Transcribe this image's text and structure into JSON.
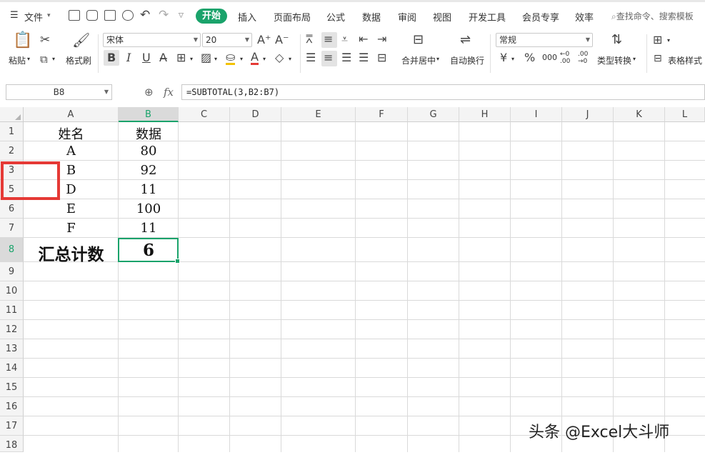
{
  "menu": {
    "file": "文件",
    "tabs": [
      "开始",
      "插入",
      "页面布局",
      "公式",
      "数据",
      "审阅",
      "视图",
      "开发工具",
      "会员专享",
      "效率"
    ],
    "search_placeholder": "查找命令、搜索模板"
  },
  "ribbon": {
    "paste": "粘贴",
    "format_painter": "格式刷",
    "font_name": "宋体",
    "font_size": "20",
    "merge_center": "合并居中",
    "wrap_text": "自动换行",
    "number_format": "常规",
    "type_convert": "类型转换",
    "table_style": "表格样式",
    "bold": "B",
    "italic": "I",
    "underline": "U",
    "currency": "¥",
    "percent": "%",
    "thousands": "000",
    "inc_decimal": "←0 .00",
    "dec_decimal": ".00 →0"
  },
  "formula_bar": {
    "name_box": "B8",
    "fx": "fx",
    "formula": "=SUBTOTAL(3,B2:B7)"
  },
  "columns": [
    "A",
    "B",
    "C",
    "D",
    "E",
    "F",
    "G",
    "H",
    "I",
    "J",
    "K",
    "L"
  ],
  "rows": [
    "1",
    "2",
    "3",
    "5",
    "6",
    "7",
    "8",
    "9",
    "10",
    "11",
    "12",
    "13",
    "14",
    "15",
    "16",
    "17",
    "18"
  ],
  "selected_cell": {
    "column": "B",
    "row": "8"
  },
  "cells": {
    "A1": "姓名",
    "B1": "数据",
    "A2": "A",
    "B2": "80",
    "A3": "B",
    "B3": "92",
    "A5": "D",
    "B5": "11",
    "A6": "E",
    "B6": "100",
    "A7": "F",
    "B7": "11",
    "A8": "汇总计数",
    "B8": "6"
  },
  "watermark": "头条 @Excel大斗师",
  "colors": {
    "accent": "#1aa36b",
    "highlight": "#e53935"
  }
}
